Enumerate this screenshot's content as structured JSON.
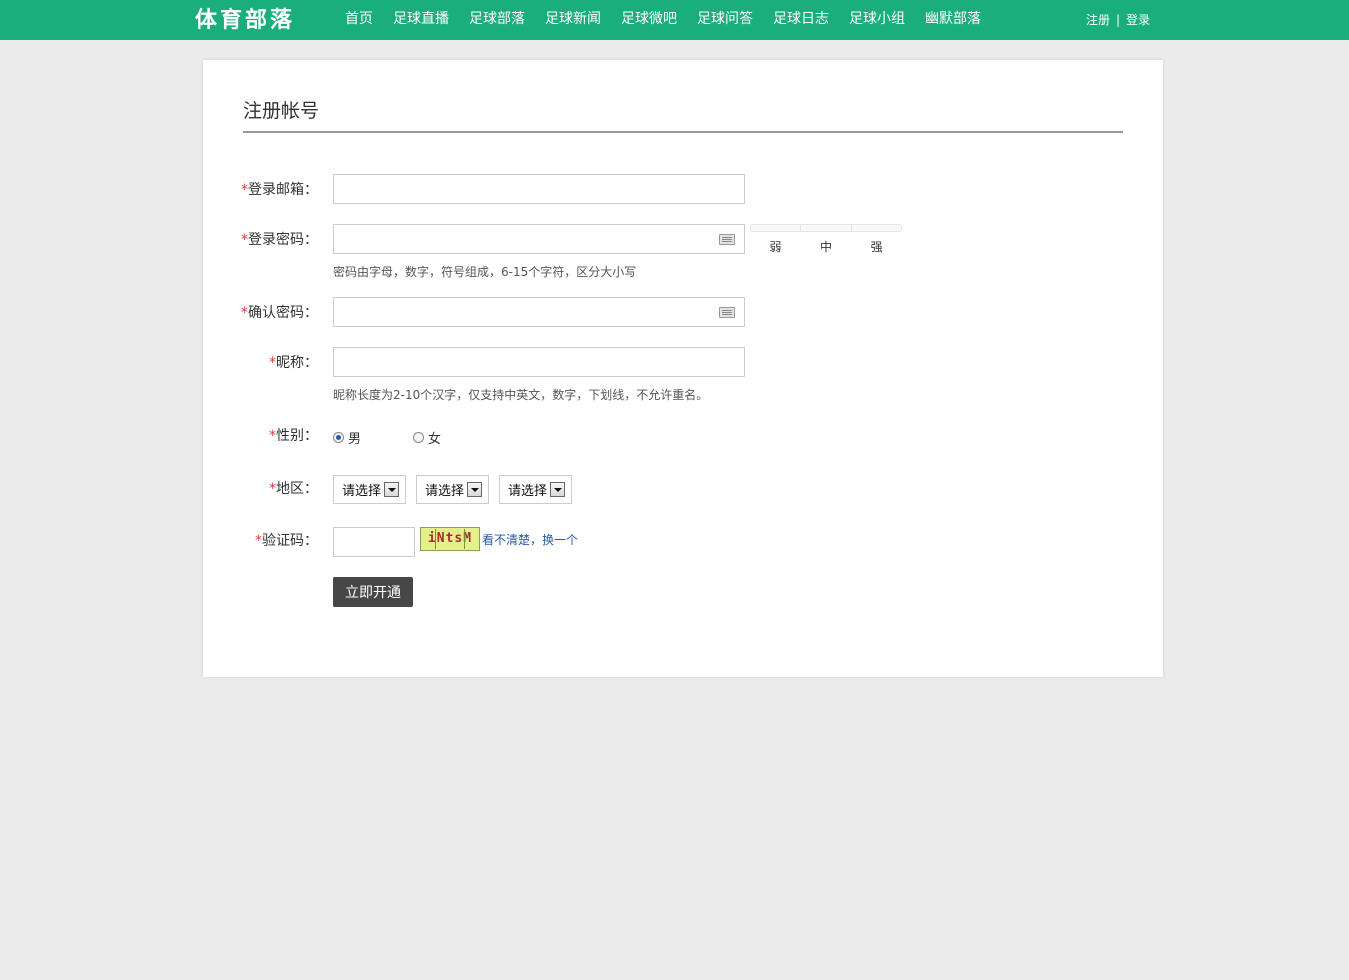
{
  "header": {
    "logo_text": "体育部落",
    "nav": [
      {
        "label": "首页"
      },
      {
        "label": "足球直播"
      },
      {
        "label": "足球部落"
      },
      {
        "label": "足球新闻"
      },
      {
        "label": "足球微吧"
      },
      {
        "label": "足球问答"
      },
      {
        "label": "足球日志"
      },
      {
        "label": "足球小组"
      },
      {
        "label": "幽默部落"
      }
    ],
    "register_link": "注册",
    "separator": "|",
    "login_link": "登录"
  },
  "form": {
    "title": "注册帐号",
    "required_mark": "*",
    "email": {
      "label": "登录邮箱：",
      "value": ""
    },
    "password": {
      "label": "登录密码：",
      "value": "",
      "hint": "密码由字母，数字，符号组成，6-15个字符，区分大小写",
      "strength_levels": [
        "弱",
        "中",
        "强"
      ]
    },
    "confirm_password": {
      "label": "确认密码：",
      "value": ""
    },
    "nickname": {
      "label": "昵称：",
      "value": "",
      "hint": "昵称长度为2-10个汉字，仅支持中英文，数字，下划线，不允许重名。"
    },
    "gender": {
      "label": "性别：",
      "options": [
        "男",
        "女"
      ],
      "selected": "男"
    },
    "region": {
      "label": "地区：",
      "selects": [
        "请选择",
        "请选择",
        "请选择"
      ]
    },
    "captcha": {
      "label": "验证码：",
      "value": "",
      "image_text": "iNtsM",
      "refresh_link": "看不清楚，换一个"
    },
    "submit_label": "立即开通"
  },
  "colors": {
    "header_bg": "#1aae7c",
    "page_bg": "#ececec",
    "required": "#e4393c",
    "link": "#2a5aa6",
    "submit_bg": "#474747"
  }
}
